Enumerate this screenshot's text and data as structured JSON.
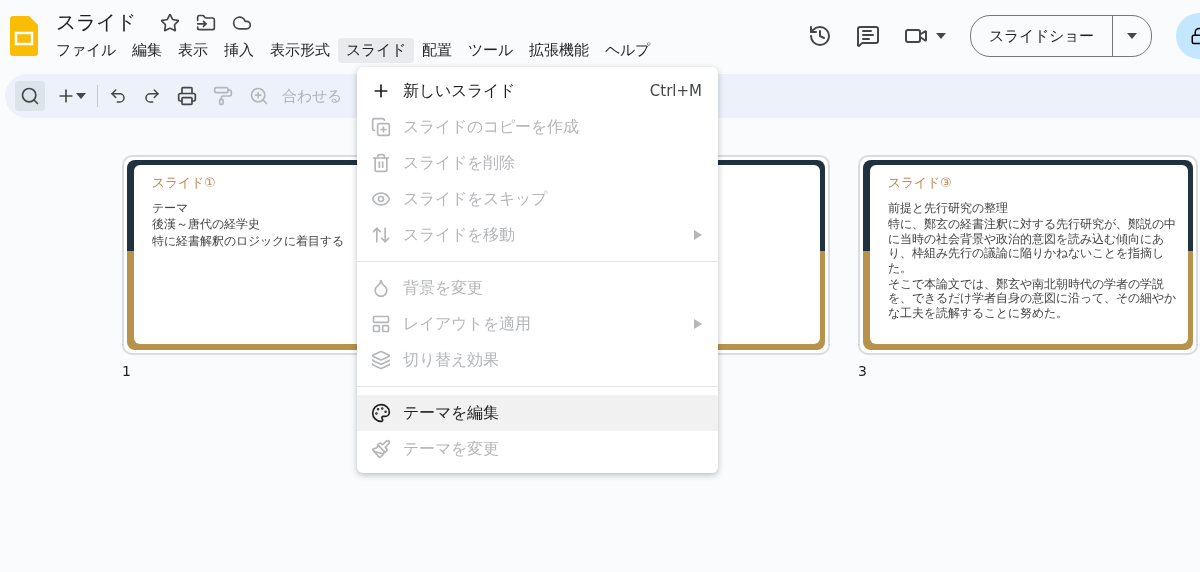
{
  "document": {
    "title": "スライド"
  },
  "menubar": [
    {
      "label": "ファイル",
      "selected": false
    },
    {
      "label": "編集",
      "selected": false
    },
    {
      "label": "表示",
      "selected": false
    },
    {
      "label": "挿入",
      "selected": false
    },
    {
      "label": "表示形式",
      "selected": false
    },
    {
      "label": "スライド",
      "selected": true
    },
    {
      "label": "配置",
      "selected": false
    },
    {
      "label": "ツール",
      "selected": false
    },
    {
      "label": "拡張機能",
      "selected": false
    },
    {
      "label": "ヘルプ",
      "selected": false
    }
  ],
  "slideshow_button": {
    "label": "スライドショー"
  },
  "toolbar": {
    "zoom_label": "合わせる"
  },
  "slides": [
    {
      "kind": "slide",
      "number": "1",
      "title": "スライド①",
      "lines": [
        "テーマ",
        "後漢～唐代の経学史",
        "特に経書解釈のロジックに着目する"
      ]
    },
    {
      "kind": "covered"
    },
    {
      "kind": "slide",
      "number": "3",
      "title": "スライド③",
      "lines": [
        "前提と先行研究の整理",
        "特に、鄭玄の経書注釈に対する先行研究が、鄭説の中に当時の社会背景や政治的意図を読み込む傾向にあり、枠組み先行の議論に陥りかねないことを指摘した。",
        "そこで本論文では、鄭玄や南北朝時代の学者の学説を、できるだけ学者自身の意図に沿って、その細やかな工夫を読解することに努めた。"
      ]
    }
  ],
  "menu": {
    "groups": [
      [
        {
          "label": "新しいスライド",
          "shortcut": "Ctrl+M",
          "disabled": false,
          "submenu": false,
          "highlighted": false
        },
        {
          "label": "スライドのコピーを作成",
          "disabled": true,
          "submenu": false,
          "highlighted": false
        },
        {
          "label": "スライドを削除",
          "disabled": true,
          "submenu": false,
          "highlighted": false
        },
        {
          "label": "スライドをスキップ",
          "disabled": true,
          "submenu": false,
          "highlighted": false
        },
        {
          "label": "スライドを移動",
          "disabled": true,
          "submenu": true,
          "highlighted": false
        }
      ],
      [
        {
          "label": "背景を変更",
          "disabled": true,
          "submenu": false,
          "highlighted": false
        },
        {
          "label": "レイアウトを適用",
          "disabled": true,
          "submenu": true,
          "highlighted": false
        },
        {
          "label": "切り替え効果",
          "disabled": true,
          "submenu": false,
          "highlighted": false
        }
      ],
      [
        {
          "label": "テーマを編集",
          "disabled": false,
          "submenu": false,
          "highlighted": true
        },
        {
          "label": "テーマを変更",
          "disabled": true,
          "submenu": false,
          "highlighted": false
        }
      ]
    ]
  }
}
